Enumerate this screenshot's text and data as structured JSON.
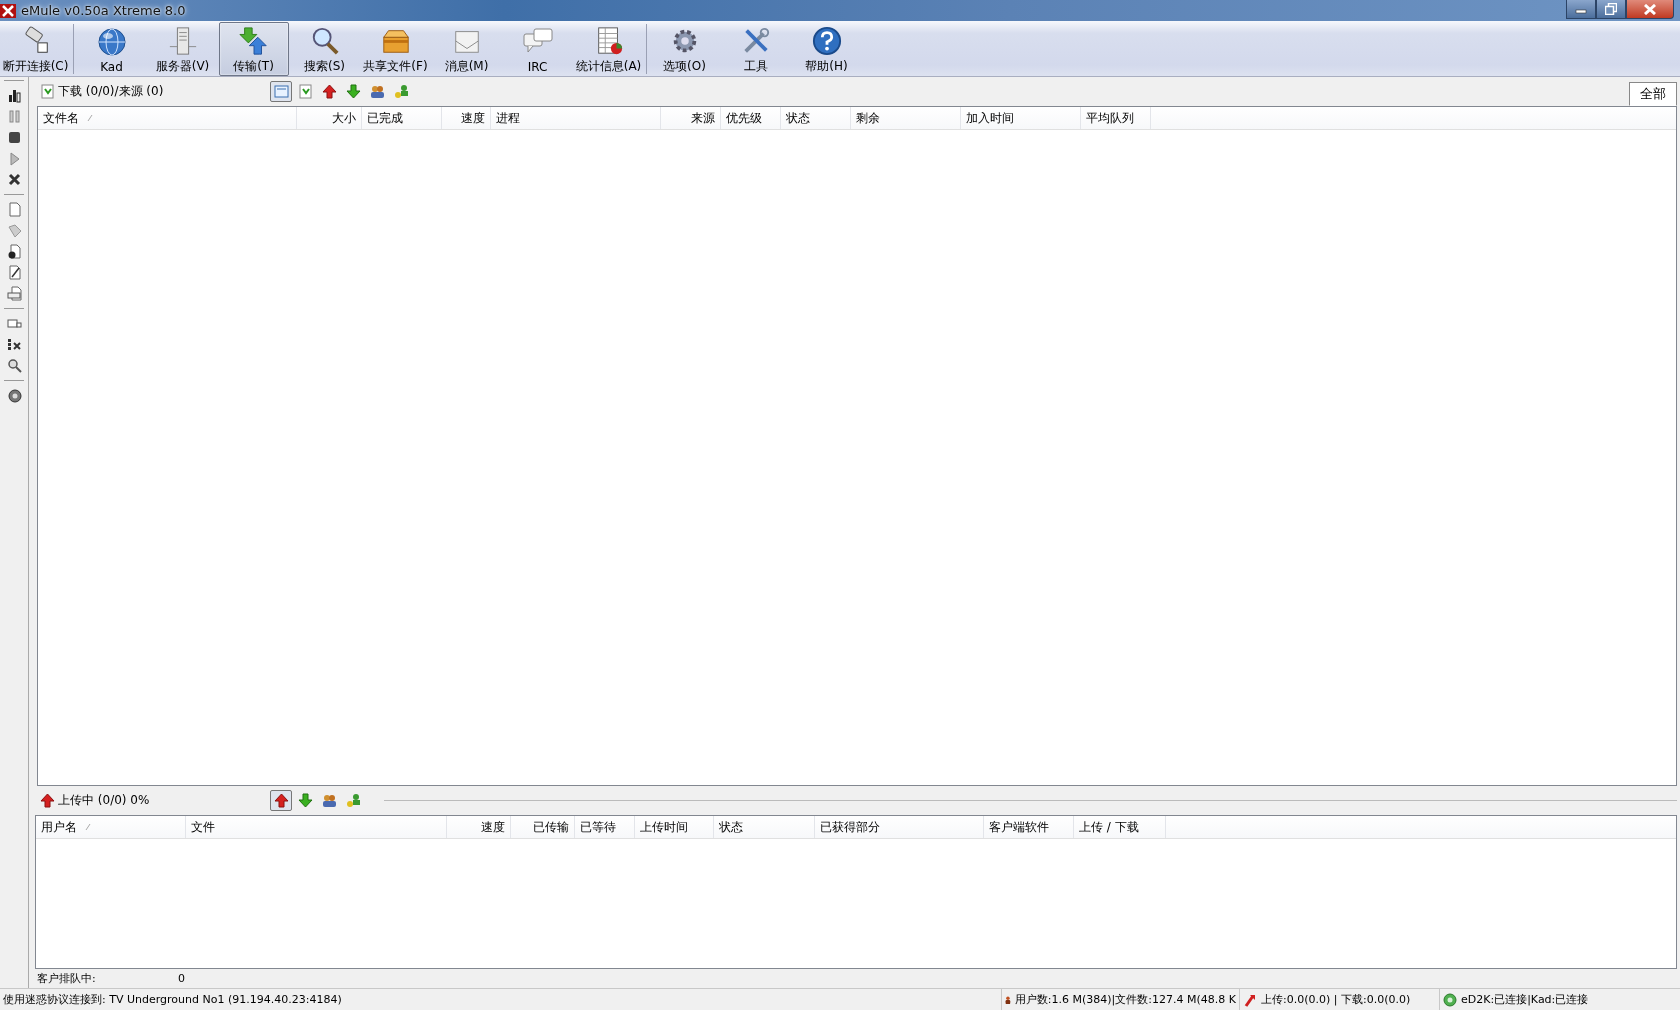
{
  "window": {
    "title": "eMule v0.50a Xtreme 8.0"
  },
  "toolbar": [
    {
      "label": "断开连接(C)",
      "selected": false
    },
    {
      "label": "Kad",
      "selected": false
    },
    {
      "label": "服务器(V)",
      "selected": false
    },
    {
      "label": "传输(T)",
      "selected": true
    },
    {
      "label": "搜索(S)",
      "selected": false
    },
    {
      "label": "共享文件(F)",
      "selected": false
    },
    {
      "label": "消息(M)",
      "selected": false
    },
    {
      "label": "IRC",
      "selected": false
    },
    {
      "label": "统计信息(A)",
      "selected": false
    },
    {
      "label": "选项(O)",
      "selected": false
    },
    {
      "label": "工具",
      "selected": false
    },
    {
      "label": "帮助(H)",
      "selected": false
    }
  ],
  "downloads": {
    "title": "下载 (0/0)/来源 (0)",
    "view_buttons": [
      {
        "selected": true
      },
      {
        "selected": false
      },
      {
        "selected": false
      },
      {
        "selected": false
      },
      {
        "selected": false
      },
      {
        "selected": false
      }
    ],
    "filter_button": "全部",
    "columns": [
      "文件名",
      "大小",
      "已完成",
      "速度",
      "进程",
      "来源",
      "优先级",
      "状态",
      "剩余",
      "加入时间",
      "平均队列"
    ]
  },
  "uploads": {
    "title": "上传中 (0/0) 0%",
    "view_buttons": [
      {
        "selected": true
      },
      {
        "selected": false
      },
      {
        "selected": false
      },
      {
        "selected": false
      }
    ],
    "columns": [
      "用户名",
      "文件",
      "速度",
      "已传输",
      "已等待",
      "上传时间",
      "状态",
      "已获得部分",
      "客户端软件",
      "上传 / 下载"
    ]
  },
  "queue": {
    "label": "客户排队中:",
    "value": "0"
  },
  "status_bar": {
    "server": "使用迷惑协议连接到: TV Underground No1 (91.194.40.23:4184)",
    "users": "用户数:1.6 M(384)|文件数:127.4 M(48.8 K",
    "transfer": "上传:0.0(0.0) | 下载:0.0(0.0)",
    "network": "eD2K:已连接|Kad:已连接"
  }
}
